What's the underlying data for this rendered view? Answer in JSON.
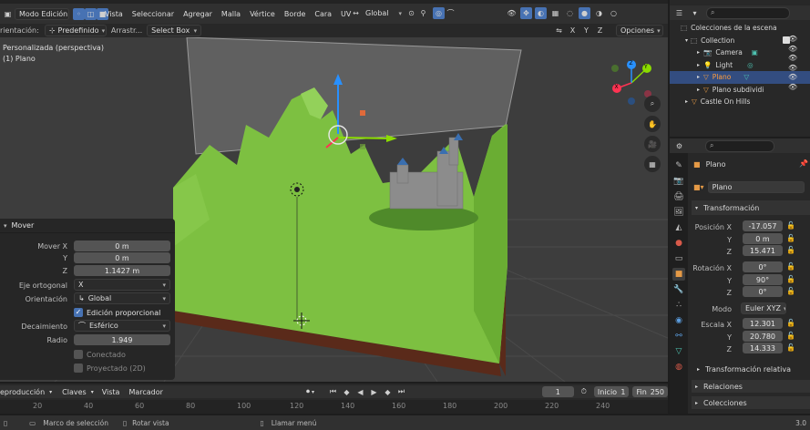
{
  "colors": {
    "header_bg": "#303030",
    "viewport_bg": "#3d3d3d",
    "terrain_green": "#7dc041",
    "accent_blue": "#4772b3",
    "axis_x": "#ff3352",
    "axis_y": "#8bdc00",
    "axis_z": "#2890ff"
  },
  "top_header": {
    "mode": "Modo Edición",
    "menus": [
      "Vista",
      "Seleccionar",
      "Agregar",
      "Malla",
      "Vértice",
      "Borde",
      "Cara",
      "UV"
    ],
    "transform_orientation": "Global"
  },
  "tool_header": {
    "orientation_label": "rientación:",
    "orientation_value": "Predefinido",
    "drag_label": "Arrastr...",
    "drag_value": "Select Box",
    "axis_x": "X",
    "axis_y": "Y",
    "axis_z": "Z",
    "options": "Opciones"
  },
  "viewport": {
    "view_name": "Personalizada (perspectiva)",
    "object_name": "(1) Plano",
    "gizmo_x": "X",
    "gizmo_y": "Y",
    "gizmo_z": "Z"
  },
  "operator_panel": {
    "title": "Mover",
    "move_x_label": "Mover X",
    "move_x": "0 m",
    "move_y_label": "Y",
    "move_y": "0 m",
    "move_z_label": "Z",
    "move_z": "1.1427 m",
    "ortho_label": "Eje ortogonal",
    "ortho_value": "X",
    "orientation_label": "Orientación",
    "orientation_value": "Global",
    "proportional": "Edición proporcional",
    "proportional_checked": true,
    "falloff_label": "Decaimiento",
    "falloff_value": "Esférico",
    "radius_label": "Radio",
    "radius_value": "1.949",
    "connected": "Conectado",
    "projected": "Proyectado (2D)"
  },
  "outliner": {
    "scene_collection": "Colecciones de la escena",
    "items": [
      {
        "label": "Collection",
        "color": "#d6d6d6"
      },
      {
        "label": "Camera",
        "color": "#d6d6d6"
      },
      {
        "label": "Light",
        "color": "#d6d6d6"
      },
      {
        "label": "Plano",
        "color": "#ff9d3d"
      },
      {
        "label": "Plano subdividi",
        "color": "#d6d6d6"
      },
      {
        "label": "Castle On Hills",
        "color": "#d6d6d6"
      }
    ]
  },
  "properties": {
    "object_name": "Plano",
    "object_field": "Plano",
    "transform_title": "Transformación",
    "location_label": "Posición X",
    "location": [
      "-17.057",
      "0 m",
      "15.471"
    ],
    "rotation_label": "Rotación X",
    "rotation": [
      "0°",
      "90°",
      "0°"
    ],
    "mode_label": "Modo",
    "mode_value": "Euler XYZ",
    "scale_label": "Escala X",
    "scale": [
      "12.301",
      "20.780",
      "14.333"
    ],
    "y_label": "Y",
    "z_label": "Z",
    "delta": "Transformación relativa",
    "relations": "Relaciones",
    "collections": "Colecciones"
  },
  "timeline": {
    "playback": "eproducción",
    "keys": "Claves",
    "view": "Vista",
    "marker": "Marcador",
    "current_frame": "1",
    "start_label": "Inicio",
    "start": "1",
    "end_label": "Fin",
    "end": "250",
    "ruler": [
      "20",
      "40",
      "60",
      "80",
      "100",
      "120",
      "140",
      "160",
      "180",
      "200",
      "220",
      "240"
    ]
  },
  "status_bar": {
    "select_box": "Marco de selección",
    "rotate_view": "Rotar vista",
    "call_menu": "Llamar menú",
    "version": "3.0"
  }
}
